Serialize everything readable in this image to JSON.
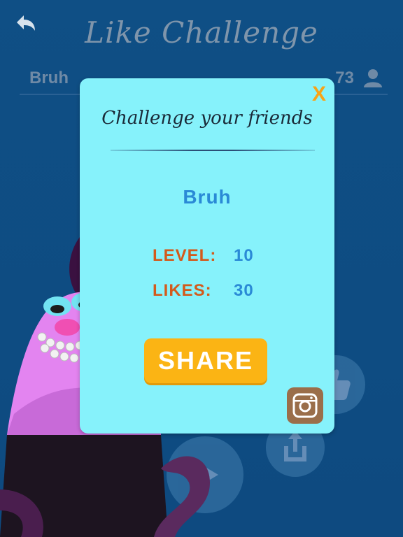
{
  "header": {
    "title": "Like Challenge",
    "back_icon": "back-arrow-icon",
    "player_name": "Bruh",
    "like_count": "73",
    "user_icon": "user-icon"
  },
  "modal": {
    "close_label": "X",
    "heading": "Challenge your friends",
    "friend_name": "Bruh",
    "level_label": "LEVEL:",
    "level_value": "10",
    "likes_label": "LIKES:",
    "likes_value": "30",
    "share_label": "SHARE",
    "instagram_icon": "instagram-icon"
  },
  "background_buttons": {
    "like_icon": "thumbs-up-icon",
    "play_icon": "play-icon",
    "share_icon": "share-icon"
  },
  "colors": {
    "background": "#0f4f85",
    "modal": "#86f2fb",
    "accent_orange": "#f7a318",
    "share_button": "#fbb414",
    "label_orange": "#d35a1c",
    "value_blue": "#2a8ad6"
  }
}
